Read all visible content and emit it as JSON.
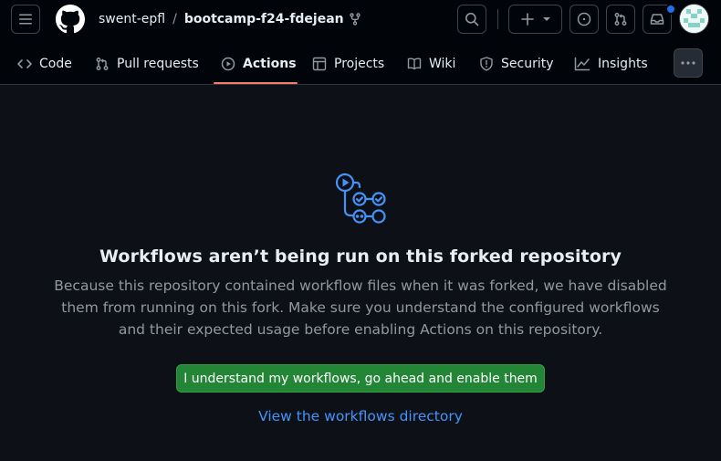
{
  "header": {
    "owner": "swent-epfl",
    "separator": "/",
    "repo": "bootcamp-f24-fdejean"
  },
  "tabs": [
    {
      "label": "Code",
      "icon": "code-icon"
    },
    {
      "label": "Pull requests",
      "icon": "git-pull-request-icon"
    },
    {
      "label": "Actions",
      "icon": "play-icon",
      "active": true
    },
    {
      "label": "Projects",
      "icon": "table-icon"
    },
    {
      "label": "Wiki",
      "icon": "book-icon"
    },
    {
      "label": "Security",
      "icon": "shield-icon"
    },
    {
      "label": "Insights",
      "icon": "graph-icon"
    }
  ],
  "main": {
    "title": "Workflows aren’t being run on this forked repository",
    "description": "Because this repository contained workflow files when it was forked, we have disabled them from running on this fork. Make sure you understand the configured workflows and their expected usage before enabling Actions on this repository.",
    "enable_button": "I understand my workflows, go ahead and enable them",
    "view_link": "View the workflows directory"
  },
  "colors": {
    "background": "#0d1117",
    "header_bg": "#010409",
    "primary_button": "#238636",
    "link": "#4493f8",
    "active_tab_underline": "#f78166",
    "notification_dot": "#1f6feb"
  }
}
